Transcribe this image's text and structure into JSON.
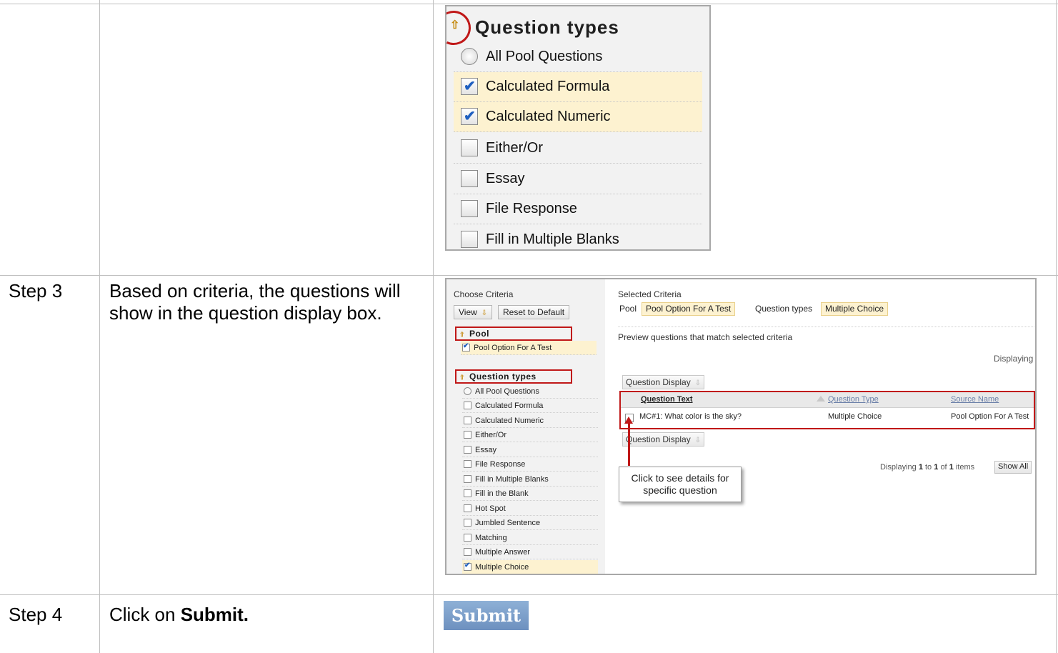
{
  "steps": [
    {
      "label": "Step 3",
      "text": "Based on criteria, the questions will show in the question display box."
    },
    {
      "label": "Step 4",
      "text_prefix": "Click on ",
      "text_bold": "Submit."
    }
  ],
  "zoom_panel": {
    "title": "Question types",
    "rows": [
      {
        "label": "All Pool Questions",
        "control": "radio",
        "checked": false
      },
      {
        "label": "Calculated Formula",
        "control": "checkbox",
        "checked": true
      },
      {
        "label": "Calculated Numeric",
        "control": "checkbox",
        "checked": true
      },
      {
        "label": "Either/Or",
        "control": "checkbox",
        "checked": false
      },
      {
        "label": "Essay",
        "control": "checkbox",
        "checked": false
      },
      {
        "label": "File Response",
        "control": "checkbox",
        "checked": false
      },
      {
        "label": "Fill in Multiple Blanks",
        "control": "checkbox",
        "checked": false
      }
    ]
  },
  "criteria": {
    "choose_label": "Choose Criteria",
    "view_button": "View",
    "reset_button": "Reset to Default",
    "pool_header": "Pool",
    "pool_item": "Pool Option For A Test",
    "qtypes_header": "Question types",
    "qtypes": [
      {
        "label": "All Pool Questions",
        "control": "radio",
        "checked": false
      },
      {
        "label": "Calculated Formula",
        "control": "checkbox",
        "checked": false
      },
      {
        "label": "Calculated Numeric",
        "control": "checkbox",
        "checked": false
      },
      {
        "label": "Either/Or",
        "control": "checkbox",
        "checked": false
      },
      {
        "label": "Essay",
        "control": "checkbox",
        "checked": false
      },
      {
        "label": "File Response",
        "control": "checkbox",
        "checked": false
      },
      {
        "label": "Fill in Multiple Blanks",
        "control": "checkbox",
        "checked": false
      },
      {
        "label": "Fill in the Blank",
        "control": "checkbox",
        "checked": false
      },
      {
        "label": "Hot Spot",
        "control": "checkbox",
        "checked": false
      },
      {
        "label": "Jumbled Sentence",
        "control": "checkbox",
        "checked": false
      },
      {
        "label": "Matching",
        "control": "checkbox",
        "checked": false
      },
      {
        "label": "Multiple Answer",
        "control": "checkbox",
        "checked": false
      },
      {
        "label": "Multiple Choice",
        "control": "checkbox",
        "checked": true
      }
    ],
    "selected_label": "Selected Criteria",
    "selected_pool_label": "Pool",
    "selected_pool_value": "Pool Option For A Test",
    "selected_qtypes_label": "Question types",
    "selected_qtypes_value": "Multiple Choice",
    "preview_label": "Preview questions that match selected criteria",
    "displaying_top": "Displaying",
    "question_display_button": "Question Display",
    "table_headers": [
      "Question Text",
      "Question Type",
      "Source Name"
    ],
    "table_row": [
      "MC#1: What color is the sky?",
      "Multiple Choice",
      "Pool Option For A Test"
    ],
    "display_count": {
      "prefix": "Displaying",
      "from": "1",
      "to_word": "to",
      "to": "1",
      "of_word": "of",
      "total": "1",
      "suffix": "items"
    },
    "show_all": "Show All",
    "callout": "Click to see details for specific question"
  },
  "submit_label": "Submit"
}
